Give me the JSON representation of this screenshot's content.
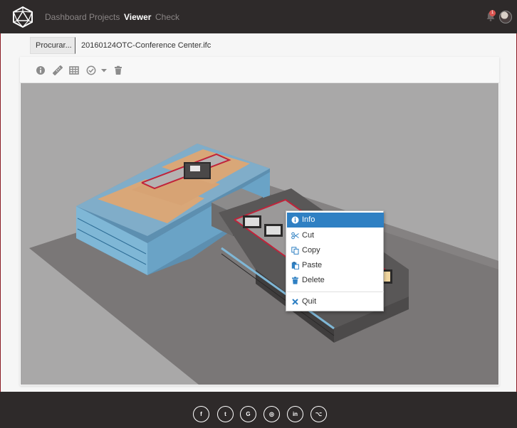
{
  "nav": {
    "logo_icon": "polyhedron-logo-icon",
    "links": [
      {
        "label": "Dashboard",
        "active": false
      },
      {
        "label": "Projects",
        "active": false
      },
      {
        "label": "Viewer",
        "active": true
      },
      {
        "label": "Check",
        "active": false
      }
    ],
    "notification_count": "1",
    "bell_icon": "bell-icon",
    "avatar": "user-avatar"
  },
  "file": {
    "browse_label": "Procurar...",
    "file_name": "20160124OTC-Conference Center.ifc"
  },
  "toolbar": {
    "tools": [
      "info-icon",
      "ruler-icon",
      "grid-icon",
      "check-circle-icon",
      "caret-down-icon",
      "trash-icon"
    ]
  },
  "context_menu": {
    "items": [
      {
        "label": "Info",
        "icon": "info-icon",
        "active": true
      },
      {
        "label": "Cut",
        "icon": "scissors-icon",
        "active": false
      },
      {
        "label": "Copy",
        "icon": "copy-icon",
        "active": false
      },
      {
        "label": "Paste",
        "icon": "paste-icon",
        "active": false
      },
      {
        "label": "Delete",
        "icon": "trash-icon",
        "active": false
      },
      {
        "label": "Quit",
        "icon": "close-icon",
        "active": false
      }
    ]
  },
  "footer": {
    "social": [
      {
        "name": "facebook",
        "glyph": "f"
      },
      {
        "name": "twitter",
        "glyph": "t"
      },
      {
        "name": "google",
        "glyph": "G"
      },
      {
        "name": "instagram",
        "glyph": "◎"
      },
      {
        "name": "linkedin",
        "glyph": "in"
      },
      {
        "name": "github",
        "glyph": "⌥"
      }
    ]
  },
  "colors": {
    "navbar": "#2e2a2a",
    "accent": "#2f80c3",
    "badge": "#d9534f",
    "canvas_bg": "#a9a8a8",
    "ground": "#7a7777",
    "roof": "#d9a778",
    "glass": "#7fb7d6",
    "highlight": "#c0233a"
  }
}
